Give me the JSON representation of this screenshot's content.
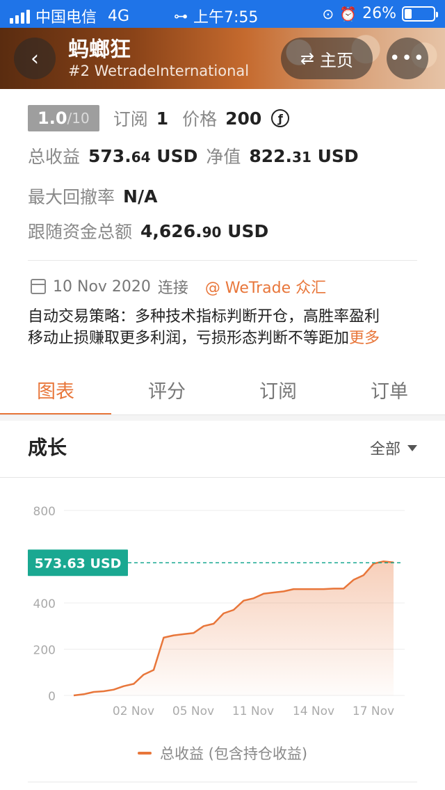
{
  "status_bar": {
    "carrier": "中国电信",
    "network": "4G",
    "time": "上午7:55",
    "battery": "26%"
  },
  "header": {
    "title": "蚂螂狂",
    "subtitle": "#2 WetradeInternational",
    "home_label": "主页"
  },
  "info": {
    "rating": "1.0",
    "rating_max": "/10",
    "subscribe_label": "订阅",
    "subscribe_count": "1",
    "price_label": "价格",
    "price_value": "200",
    "total_profit_label": "总收益",
    "total_profit_int": "573.",
    "total_profit_dec": "64",
    "total_profit_unit": "USD",
    "net_value_label": "净值",
    "net_value_int": "822.",
    "net_value_dec": "31",
    "net_value_unit": "USD",
    "max_drawdown_label": "最大回撤率",
    "max_drawdown_value": "N/A",
    "follow_funds_label": "跟随资金总额",
    "follow_funds_int": "4,626.",
    "follow_funds_dec": "90",
    "follow_funds_unit": "USD",
    "connect_date": "10 Nov 2020",
    "connect_label": "连接",
    "broker": "@ WeTrade 众汇",
    "description_line1": "自动交易策略：多种技术指标判断开仓，高胜率盈利",
    "description_line2": "移动止损赚取更多利润，亏损形态判断不等距加",
    "more_label": "更多"
  },
  "tabs": [
    {
      "label": "图表",
      "active": true
    },
    {
      "label": "评分",
      "active": false
    },
    {
      "label": "订阅",
      "active": false
    },
    {
      "label": "订单",
      "active": false
    }
  ],
  "growth": {
    "title": "成长",
    "filter_label": "全部"
  },
  "chart_data": {
    "type": "area",
    "ylim": [
      0,
      800
    ],
    "yticks": [
      "0",
      "200",
      "400",
      "800"
    ],
    "ytick_values": [
      0,
      200,
      400,
      800
    ],
    "xtick_labels": [
      "02 Nov",
      "05 Nov",
      "11 Nov",
      "14 Nov",
      "17 Nov"
    ],
    "current_value_label": "573.63 USD",
    "current_value": 573.63,
    "series": [
      {
        "name": "总收益 (包含持仓收益)",
        "color": "#e8763a",
        "values": [
          0,
          5,
          15,
          18,
          25,
          40,
          50,
          90,
          110,
          250,
          260,
          265,
          270,
          300,
          310,
          355,
          370,
          410,
          420,
          440,
          445,
          450,
          460,
          460,
          460,
          460,
          462,
          462,
          500,
          520,
          570,
          580,
          575
        ]
      }
    ],
    "legend_label": "总收益 (包含持仓收益)",
    "accent_color": "#1aa891",
    "grid": true
  }
}
